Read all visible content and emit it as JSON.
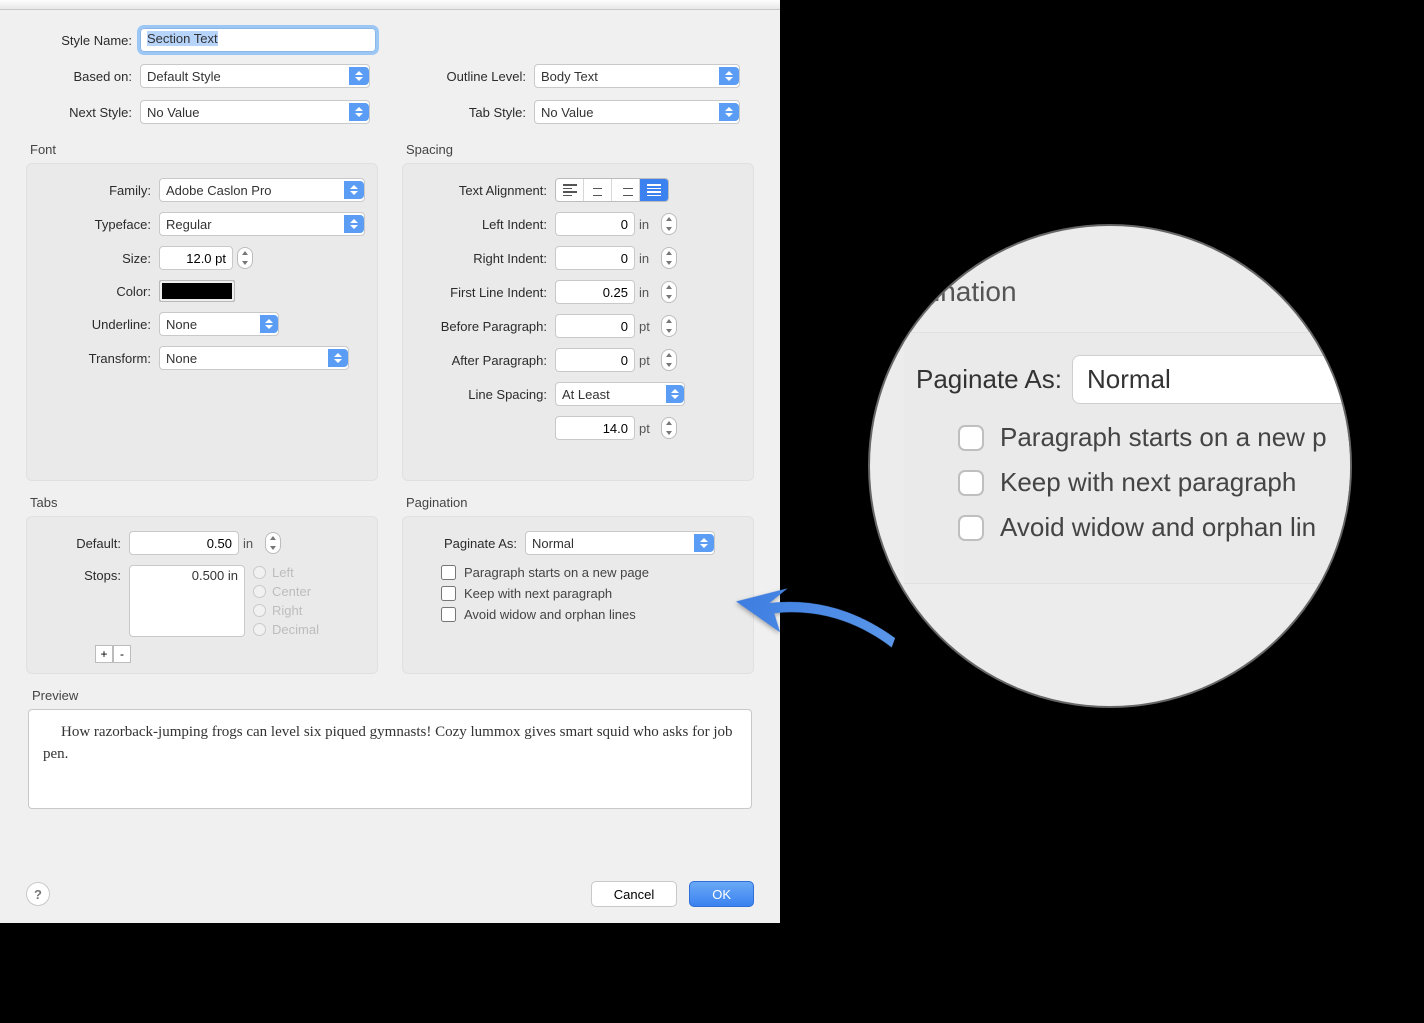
{
  "header": {
    "styleName_label": "Style Name:",
    "styleName_value": "Section Text",
    "basedOn_label": "Based on:",
    "basedOn_value": "Default Style",
    "nextStyle_label": "Next Style:",
    "nextStyle_value": "No Value",
    "outlineLevel_label": "Outline Level:",
    "outlineLevel_value": "Body Text",
    "tabStyle_label": "Tab Style:",
    "tabStyle_value": "No Value"
  },
  "font": {
    "title": "Font",
    "family_label": "Family:",
    "family_value": "Adobe Caslon Pro",
    "typeface_label": "Typeface:",
    "typeface_value": "Regular",
    "size_label": "Size:",
    "size_value": "12.0 pt",
    "color_label": "Color:",
    "color_value": "#000000",
    "underline_label": "Underline:",
    "underline_value": "None",
    "transform_label": "Transform:",
    "transform_value": "None"
  },
  "spacing": {
    "title": "Spacing",
    "textAlignment_label": "Text Alignment:",
    "leftIndent_label": "Left Indent:",
    "leftIndent_value": "0",
    "leftIndent_unit": "in",
    "rightIndent_label": "Right Indent:",
    "rightIndent_value": "0",
    "rightIndent_unit": "in",
    "firstLine_label": "First Line Indent:",
    "firstLine_value": "0.25",
    "firstLine_unit": "in",
    "before_label": "Before Paragraph:",
    "before_value": "0",
    "before_unit": "pt",
    "after_label": "After Paragraph:",
    "after_value": "0",
    "after_unit": "pt",
    "lineSpacing_label": "Line Spacing:",
    "lineSpacing_value": "At Least",
    "lineSpacing_amount": "14.0",
    "lineSpacing_unit": "pt"
  },
  "tabs": {
    "title": "Tabs",
    "default_label": "Default:",
    "default_value": "0.50",
    "default_unit": "in",
    "stops_label": "Stops:",
    "stops_value": "0.500 in",
    "add_label": "+",
    "remove_label": "-",
    "radios": {
      "left": "Left",
      "center": "Center",
      "right": "Right",
      "decimal": "Decimal"
    }
  },
  "pagination": {
    "title": "Pagination",
    "paginateAs_label": "Paginate As:",
    "paginateAs_value": "Normal",
    "newPage_label": "Paragraph starts on a new page",
    "keepNext_label": "Keep with next paragraph",
    "widow_label": "Avoid widow and orphan lines"
  },
  "preview": {
    "title": "Preview",
    "text": "How razorback-jumping frogs can level six piqued gymnasts! Cozy lummox gives smart squid who asks for job pen."
  },
  "footer": {
    "help": "?",
    "cancel": "Cancel",
    "ok": "OK"
  },
  "lens": {
    "title_fragment": "ination",
    "paginateAs_label": "Paginate As:",
    "paginateAs_value": "Normal",
    "newPage_label": "Paragraph starts on a new p",
    "keepNext_label": "Keep with next paragraph",
    "widow_label": "Avoid widow and orphan lin"
  }
}
